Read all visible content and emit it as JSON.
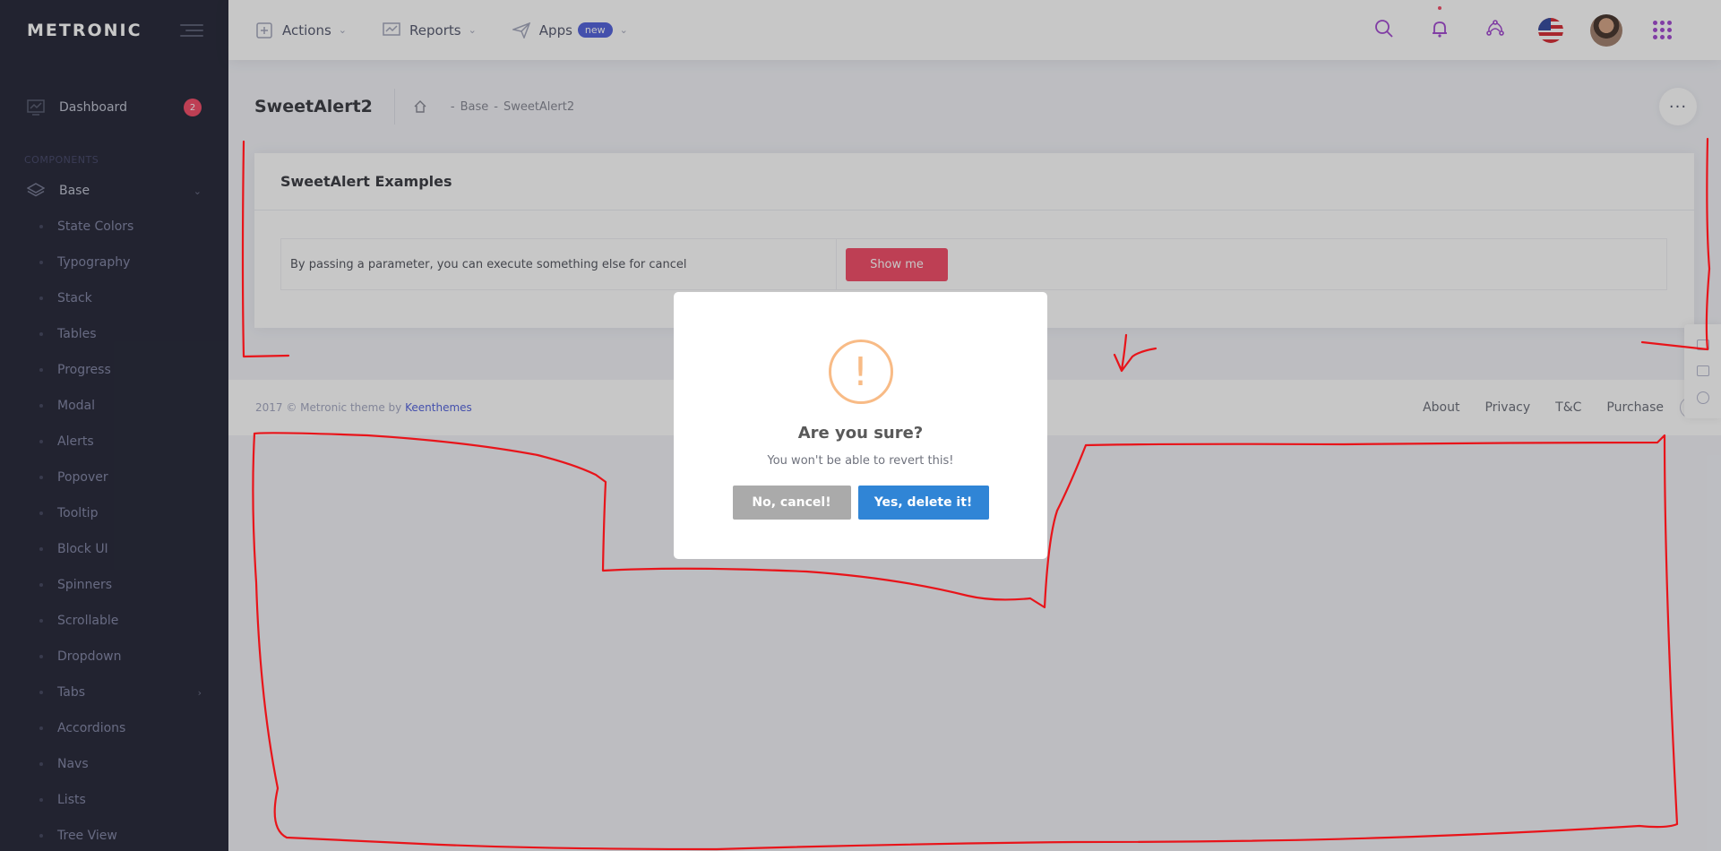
{
  "sidebar": {
    "brand": "METRONIC",
    "dashboard_label": "Dashboard",
    "dashboard_badge": "2",
    "section_title": "COMPONENTS",
    "base_label": "Base",
    "items": [
      {
        "label": "State Colors"
      },
      {
        "label": "Typography"
      },
      {
        "label": "Stack"
      },
      {
        "label": "Tables"
      },
      {
        "label": "Progress"
      },
      {
        "label": "Modal"
      },
      {
        "label": "Alerts"
      },
      {
        "label": "Popover"
      },
      {
        "label": "Tooltip"
      },
      {
        "label": "Block UI"
      },
      {
        "label": "Spinners"
      },
      {
        "label": "Scrollable"
      },
      {
        "label": "Dropdown"
      },
      {
        "label": "Tabs"
      },
      {
        "label": "Accordions"
      },
      {
        "label": "Navs"
      },
      {
        "label": "Lists"
      },
      {
        "label": "Tree View"
      }
    ]
  },
  "header": {
    "nav": {
      "actions": "Actions",
      "reports": "Reports",
      "apps": "Apps",
      "apps_badge": "new"
    }
  },
  "subheader": {
    "title": "SweetAlert2",
    "breadcrumb": [
      "Base",
      "SweetAlert2"
    ]
  },
  "portlet": {
    "title": "SweetAlert Examples",
    "row_text": "By passing a parameter, you can execute something else for cancel",
    "button_label": "Show me"
  },
  "footer": {
    "copyright": "2017 © Metronic theme by",
    "author": "Keenthemes",
    "links": [
      "About",
      "Privacy",
      "T&C",
      "Purchase"
    ],
    "help": "?"
  },
  "modal": {
    "icon": "!",
    "title": "Are you sure?",
    "text": "You won't be able to revert this!",
    "cancel_label": "No, cancel!",
    "confirm_label": "Yes, delete it!"
  },
  "icons": {
    "search": "search-icon",
    "notifications": "bell-icon",
    "quick_actions": "share-icon",
    "language": "us-flag-icon",
    "apps_grid": "grid-icon"
  },
  "colors": {
    "accent": "#5867dd",
    "danger": "#f4516c",
    "confirm": "#3085d6",
    "cancel": "#aaaaaa",
    "warning": "#f8bb86",
    "annotation": "#e8141a"
  }
}
